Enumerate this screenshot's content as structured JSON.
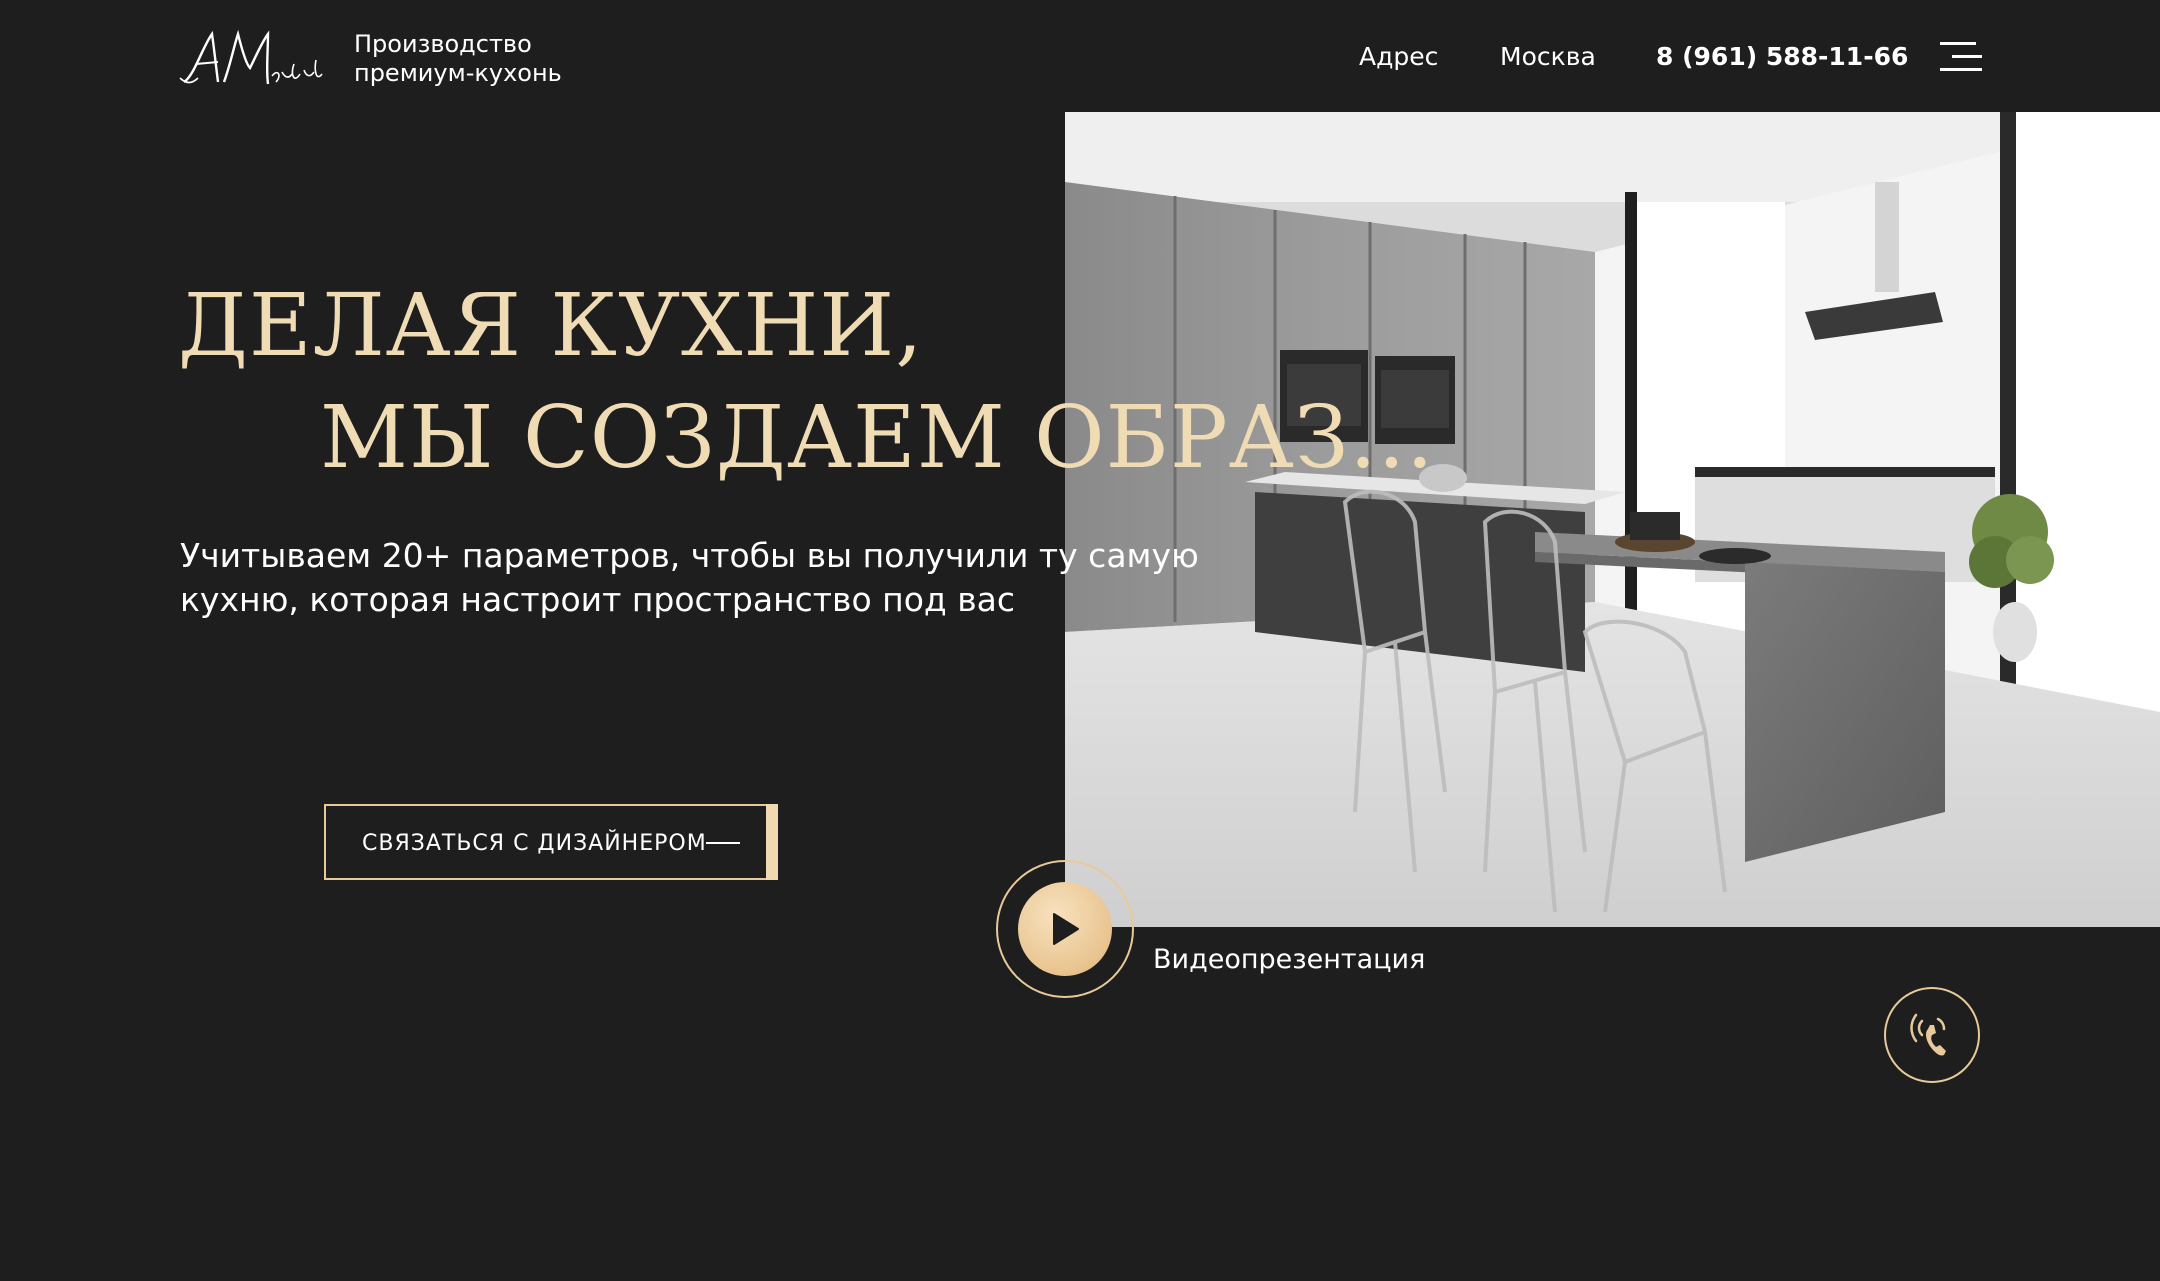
{
  "header": {
    "logo_alt": "АМебель",
    "tagline_line1": "Производство",
    "tagline_line2": "премиум-кухонь",
    "nav": {
      "address_label": "Адрес",
      "city_label": "Москва",
      "phone": "8 (961) 588-11-66"
    },
    "menu_icon": "hamburger-menu-icon"
  },
  "hero": {
    "headline_line1": "ДЕЛАЯ КУХНИ,",
    "headline_line2": "МЫ СОЗДАЕМ ОБРАЗ...",
    "subtitle": "Учитываем 20+ параметров, чтобы вы получили ту самую кухню, которая настроит пространство под вас",
    "image": "kitchen-interior-photo"
  },
  "cta": {
    "label": "СВЯЗАТЬСЯ С ДИЗАЙНЕРОМ"
  },
  "video": {
    "label": "Видеопрезентация",
    "icon": "play-icon"
  },
  "call": {
    "icon": "phone-icon"
  },
  "colors": {
    "background": "#1e1e1f",
    "accent_gold": "#f0dcb4",
    "border_gold": "#e8c99a",
    "text": "#ffffff"
  }
}
